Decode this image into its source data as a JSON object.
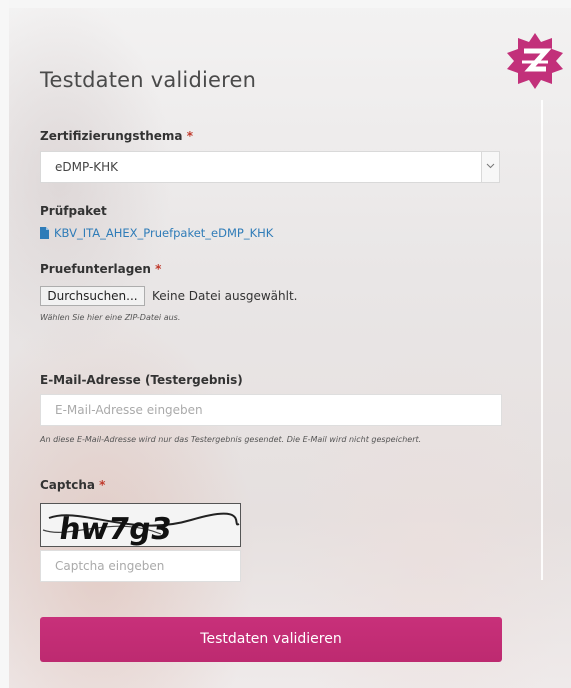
{
  "form": {
    "title": "Testdaten validieren",
    "topic_label": "Zertifizierungsthema",
    "topic_value": "eDMP-KHK",
    "package_label": "Prüfpaket",
    "package_file": "KBV_ITA_AHEX_Pruefpaket_eDMP_KHK",
    "docs_label": "Pruefunterlagen",
    "browse_label": "Durchsuchen...",
    "no_file_text": "Keine Datei ausgewählt.",
    "zip_hint": "Wählen Sie hier eine ZIP-Datei aus.",
    "email_label": "E-Mail-Adresse (Testergebnis)",
    "email_placeholder": "E-Mail-Adresse eingeben",
    "email_hint": "An diese E-Mail-Adresse wird nur das Testergebnis gesendet. Die E-Mail wird nicht gespeichert.",
    "captcha_label": "Captcha",
    "captcha_text": "hw7g3",
    "captcha_placeholder": "Captcha eingeben",
    "required_mark": "*",
    "submit_label": "Testdaten validieren"
  },
  "colors": {
    "accent": "#c2307a",
    "link": "#2f7cb8",
    "required": "#c0392b"
  },
  "icons": {
    "logo": "z-star-logo",
    "file": "file-icon",
    "dropdown": "chevron-down-icon"
  }
}
